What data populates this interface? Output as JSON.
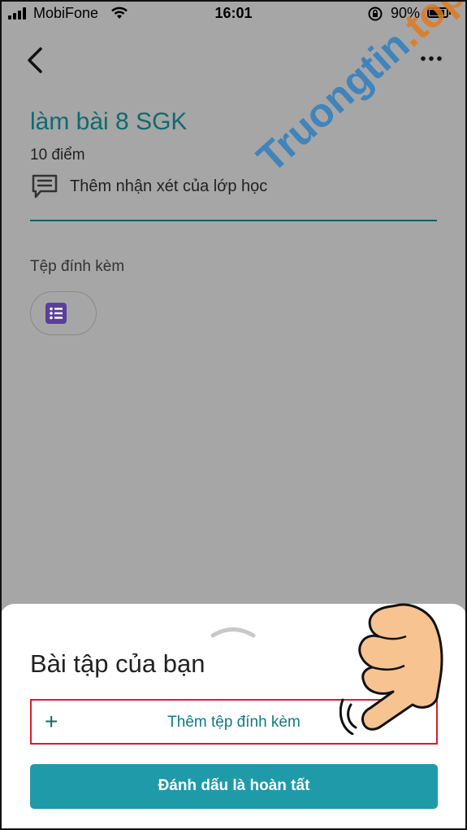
{
  "status_bar": {
    "carrier": "MobiFone",
    "time": "16:01",
    "battery_percent": "90%",
    "battery_level": 0.9,
    "icons": [
      "signal-icon",
      "wifi-icon",
      "orientation-lock-icon",
      "battery-icon"
    ]
  },
  "header": {
    "icons": [
      "back-arrow-icon",
      "more-options-icon"
    ]
  },
  "assignment": {
    "title": "làm bài 8 SGK",
    "points": "10 điểm",
    "class_comment": "Thêm nhận xét của lớp học",
    "attachments_label": "Tệp đính kèm",
    "attachment_icon": "document-list-icon"
  },
  "watermark": {
    "main": "Truongtin",
    "tld": ".top"
  },
  "sheet": {
    "title": "Bài tập của bạn",
    "add_attachment_icon": "plus-icon",
    "add_attachment": "Thêm tệp đính kèm",
    "mark_done": "Đánh dấu là hoàn tất"
  },
  "colors": {
    "accent": "#1f9aa8",
    "title_teal": "#0f6b6f",
    "highlight_border": "#d81f2a",
    "attachment_purple": "#5b3f9c",
    "dim_overlay": "#a6a6a6"
  }
}
